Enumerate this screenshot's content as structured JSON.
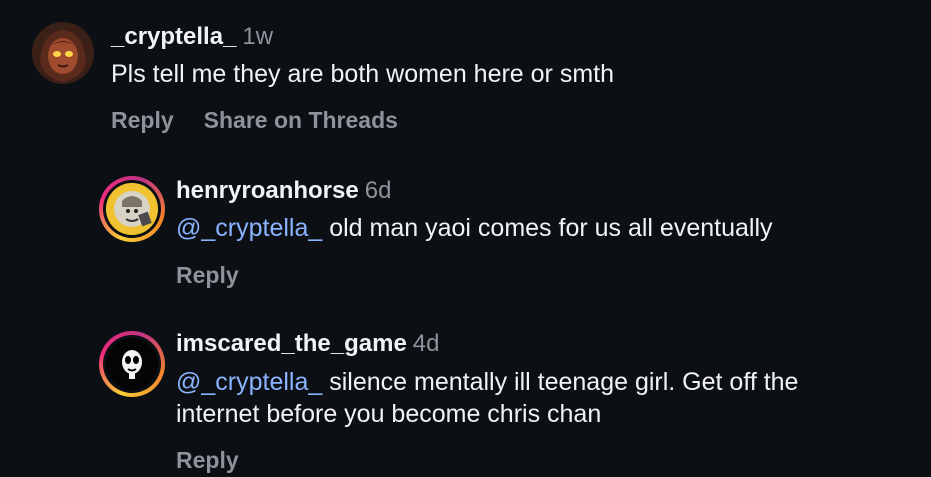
{
  "comments": [
    {
      "username": "_cryptella_",
      "time": "1w",
      "text": "Pls tell me they are both women here or smth",
      "actions": {
        "reply": "Reply",
        "share": "Share on Threads"
      }
    },
    {
      "username": "henryroanhorse",
      "time": "6d",
      "mention": "@_cryptella_",
      "text": " old man yaoi comes for us all eventually",
      "actions": {
        "reply": "Reply"
      }
    },
    {
      "username": "imscared_the_game",
      "time": "4d",
      "mention": "@_cryptella_",
      "text_line1": " silence mentally ill teenage girl. Get off the",
      "text_line2": "internet before you become chris chan",
      "actions": {
        "reply": "Reply"
      }
    }
  ],
  "colors": {
    "background": "#0c0f14",
    "mention": "#8ab4ff",
    "muted": "#8e939b"
  }
}
